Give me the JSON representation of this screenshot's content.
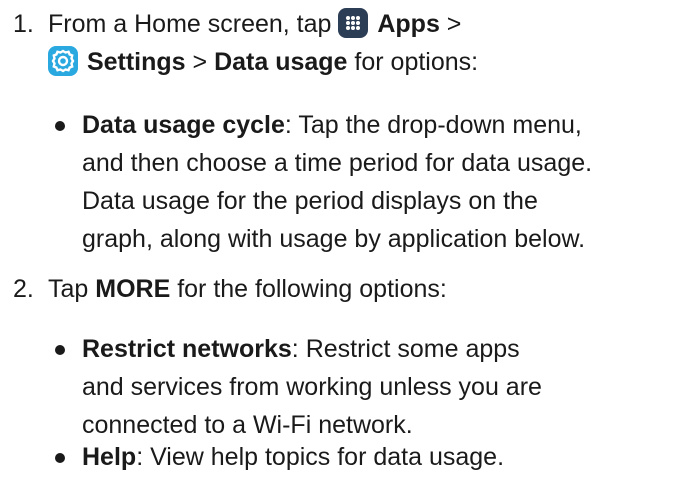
{
  "steps": [
    {
      "number": "1.",
      "line1_prefix": "From a Home screen, tap ",
      "apps_icon": "apps-grid-icon",
      "apps_label": "Apps",
      "sep1": " >",
      "settings_icon": "settings-gear-icon",
      "settings_label": "Settings",
      "sep2": " > ",
      "data_usage_label": "Data usage",
      "line2_suffix": " for options:",
      "bullets": [
        {
          "title": "Data usage cycle",
          "lines": [
            ": Tap the drop-down menu,",
            "and then choose a time period for data usage.",
            "Data usage for the period displays on the",
            "graph, along with usage by application below."
          ]
        }
      ]
    },
    {
      "number": "2.",
      "prefix": "Tap ",
      "more_label": "MORE",
      "suffix": " for the following options:",
      "bullets": [
        {
          "title": "Restrict networks",
          "lines": [
            ": Restrict some apps",
            "and services from working unless you are",
            "connected to a Wi-Fi network."
          ]
        },
        {
          "title": "Help",
          "lines": [
            ": View help topics for data usage."
          ]
        }
      ]
    }
  ],
  "colors": {
    "text": "#1a1a1a",
    "apps_icon_bg": "#2c3e55",
    "settings_icon_bg": "#2aa8e0"
  }
}
